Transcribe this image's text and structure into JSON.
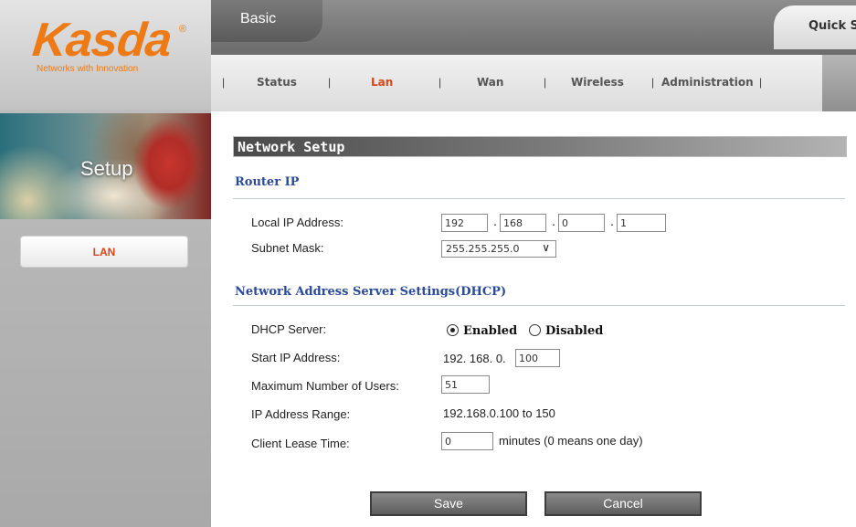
{
  "brand": {
    "logo_text": "Kasda",
    "registered_mark": "®",
    "tagline": "Networks with Innovation"
  },
  "top_tabs": {
    "active": "Basic",
    "right_partial": "Quick S"
  },
  "nav": {
    "items": [
      "Status",
      "Lan",
      "Wan",
      "Wireless",
      "Administration"
    ],
    "active": "Lan",
    "separator": "|"
  },
  "sidebar": {
    "banner_title": "Setup",
    "items": [
      {
        "label": "LAN"
      }
    ]
  },
  "page": {
    "section_title": "Network Setup"
  },
  "router_ip": {
    "heading": "Router IP",
    "local_ip_label": "Local IP Address:",
    "local_ip": [
      "192",
      "168",
      "0",
      "1"
    ],
    "subnet_label": "Subnet Mask:",
    "subnet_value": "255.255.255.0"
  },
  "dhcp": {
    "heading": "Network Address Server Settings(DHCP)",
    "server_label": "DHCP Server:",
    "enabled_label": "Enabled",
    "disabled_label": "Disabled",
    "selected": "Enabled",
    "start_ip_label": "Start IP Address:",
    "start_ip_prefix": "192. 168. 0.",
    "start_ip_last": "100",
    "max_users_label": "Maximum Number of Users:",
    "max_users": "51",
    "range_label": "IP Address Range:",
    "range_value": "192.168.0.100 to 150",
    "lease_label": "Client Lease Time:",
    "lease_value": "0",
    "lease_unit": "minutes (0 means one day)"
  },
  "buttons": {
    "save": "Save",
    "cancel": "Cancel"
  },
  "colors": {
    "accent_orange": "#ee7a16",
    "heading_blue": "#2a4a9a",
    "nav_active": "#d9461c"
  }
}
